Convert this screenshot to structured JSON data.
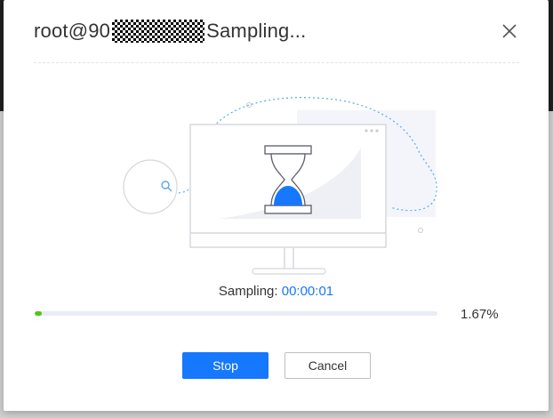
{
  "dialog": {
    "title_prefix": "root@90",
    "title_suffix": "Sampling..."
  },
  "status": {
    "label": "Sampling: ",
    "elapsed": "00:00:01"
  },
  "progress": {
    "value_percent": 1.67,
    "text": "1.67%",
    "color": "#52c41a"
  },
  "buttons": {
    "stop_label": "Stop",
    "cancel_label": "Cancel"
  },
  "icons": {
    "close": "close-icon",
    "illustration": "hourglass-monitor-illustration"
  },
  "colors": {
    "primary": "#1677ff"
  }
}
